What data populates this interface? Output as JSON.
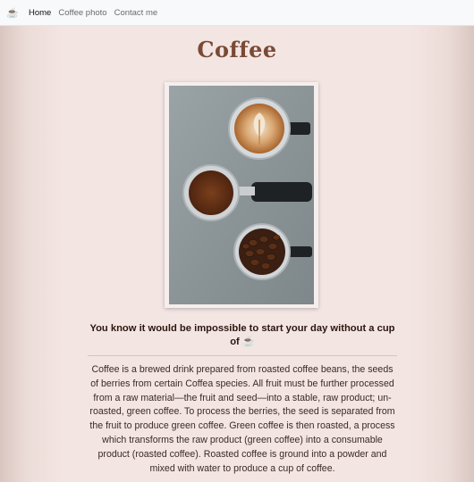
{
  "nav": {
    "brand_icon": "☕",
    "links": [
      "Home",
      "Coffee photo",
      "Contact me"
    ]
  },
  "main": {
    "title": "Coffee",
    "tagline": "You know it would be impossible to start your day without a cup of ☕",
    "description": "Coffee is a brewed drink prepared from roasted coffee beans, the seeds of berries from certain Coffea species. All fruit must be further processed from a raw material—the fruit and seed—into a stable, raw product; un-roasted, green coffee. To process the berries, the seed is separated from the fruit to produce green coffee. Green coffee is then roasted, a process which transforms the raw product (green coffee) into a consumable product (roasted coffee). Roasted coffee is ground into a powder and mixed with water to produce a cup of coffee."
  },
  "colors": {
    "title": "#7a4a36",
    "page_background": "#f3e5e2"
  }
}
